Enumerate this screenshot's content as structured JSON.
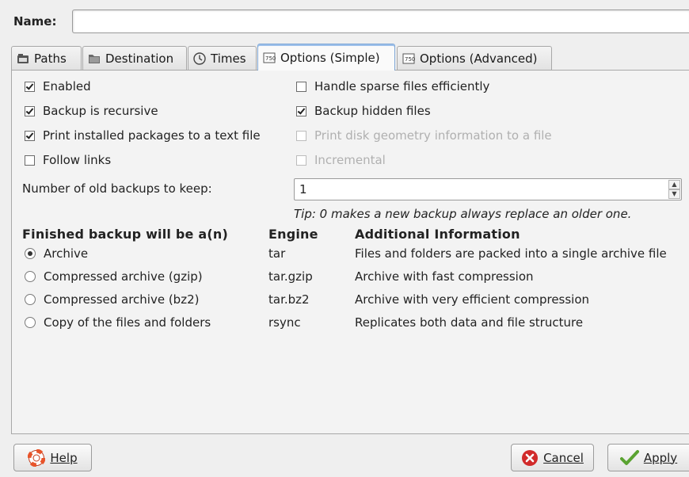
{
  "name": {
    "label": "Name:",
    "value": ""
  },
  "tabs": [
    {
      "label": "Paths",
      "icon": "paths-icon"
    },
    {
      "label": "Destination",
      "icon": "folder-icon"
    },
    {
      "label": "Times",
      "icon": "clock-icon"
    },
    {
      "label": "Options (Simple)",
      "icon": "options-icon",
      "active": true
    },
    {
      "label": "Options (Advanced)",
      "icon": "options-icon"
    }
  ],
  "options": {
    "enabled": {
      "label": "Enabled",
      "checked": true
    },
    "recursive": {
      "label": "Backup is recursive",
      "checked": true
    },
    "print_packages": {
      "label": "Print installed packages to a text file",
      "checked": true
    },
    "follow_links": {
      "label": "Follow links",
      "checked": false
    },
    "sparse": {
      "label": "Handle sparse files efficiently",
      "checked": false
    },
    "hidden": {
      "label": "Backup hidden files",
      "checked": true
    },
    "disk_geometry": {
      "label": "Print disk geometry information to a file",
      "checked": false,
      "disabled": true
    },
    "incremental": {
      "label": "Incremental",
      "checked": false,
      "disabled": true
    }
  },
  "old_backups": {
    "label": "Number of old backups to keep:",
    "value": "1",
    "tip": "Tip: 0 makes a new backup always replace an older one."
  },
  "table": {
    "headers": [
      "Finished backup will be a(n)",
      "Engine",
      "Additional Information"
    ],
    "rows": [
      {
        "type": "Archive",
        "engine": "tar",
        "info": "Files and folders are packed into a single archive file",
        "selected": true
      },
      {
        "type": "Compressed archive (gzip)",
        "engine": "tar.gzip",
        "info": "Archive with fast compression"
      },
      {
        "type": "Compressed archive (bz2)",
        "engine": "tar.bz2",
        "info": "Archive with very efficient compression"
      },
      {
        "type": "Copy of the files and folders",
        "engine": "rsync",
        "info": "Replicates both data and file structure"
      }
    ]
  },
  "buttons": {
    "help": "Help",
    "cancel": "Cancel",
    "apply": "Apply"
  },
  "colors": {
    "cancel_icon": "#d12a2a",
    "apply_icon": "#5aa331",
    "help_icon": "#e8542a",
    "active_tab_border": "#7fa7d6"
  }
}
